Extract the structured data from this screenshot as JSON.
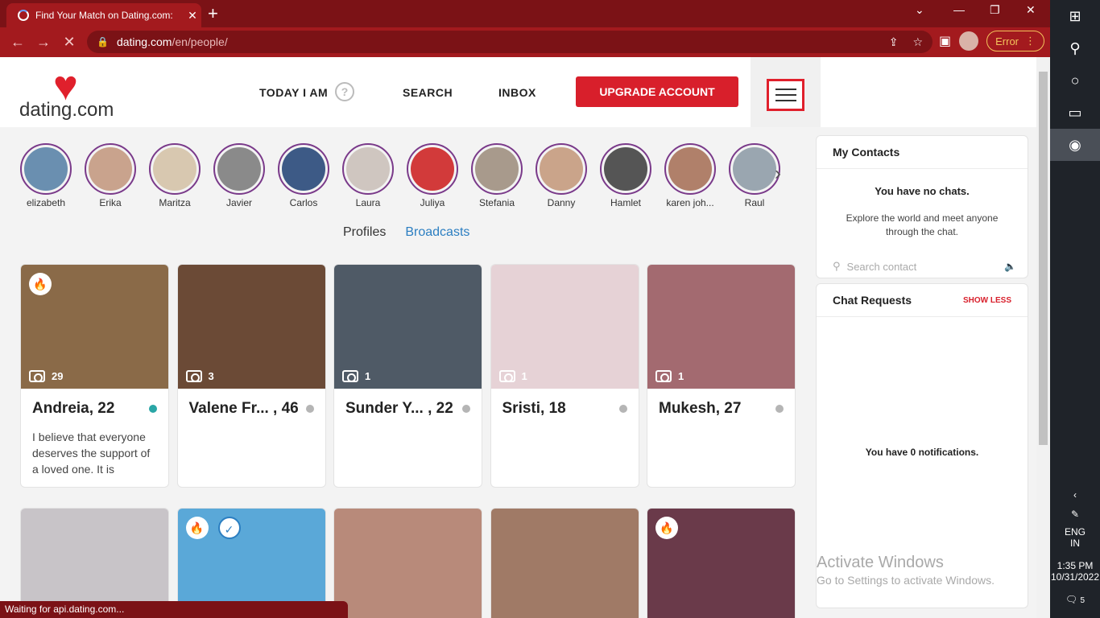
{
  "browser": {
    "tab_title": "Find Your Match on Dating.com:",
    "url_host": "dating.com",
    "url_path": "/en/people/",
    "error_label": "Error",
    "status_text": "Waiting for api.dating.com..."
  },
  "header": {
    "logo_text": "dating.com",
    "nav": {
      "today": "TODAY I AM",
      "search": "SEARCH",
      "inbox": "INBOX"
    },
    "upgrade_label": "UPGRADE ACCOUNT"
  },
  "stories": [
    {
      "name": "elizabeth",
      "color": "#6a8fb0"
    },
    {
      "name": "Erika",
      "color": "#c9a38d"
    },
    {
      "name": "Maritza",
      "color": "#d8c8b0"
    },
    {
      "name": "Javier",
      "color": "#8a8a8a"
    },
    {
      "name": "Carlos",
      "color": "#3d5a86"
    },
    {
      "name": "Laura",
      "color": "#cfc6c0"
    },
    {
      "name": "Juliya",
      "color": "#d23a3a"
    },
    {
      "name": "Stefania",
      "color": "#a89a8c"
    },
    {
      "name": "Danny",
      "color": "#caa48a"
    },
    {
      "name": "Hamlet",
      "color": "#555555"
    },
    {
      "name": "karen joh...",
      "color": "#b0806a"
    },
    {
      "name": "Raul",
      "color": "#9aa6b0"
    }
  ],
  "tabs": {
    "profiles": "Profiles",
    "broadcasts": "Broadcasts"
  },
  "cards_row1": [
    {
      "name": "Andreia, 22",
      "photos": "29",
      "online": true,
      "flame": true,
      "bio": "I believe that everyone deserves the support of a loved one. It is",
      "color": "#8a6a48"
    },
    {
      "name": "Valene Fr... , 46",
      "photos": "3",
      "online": false,
      "flame": false,
      "bio": "",
      "color": "#6b4a36"
    },
    {
      "name": "Sunder Y... , 22",
      "photos": "1",
      "online": false,
      "flame": false,
      "bio": "",
      "color": "#4f5a66"
    },
    {
      "name": "Sristi, 18",
      "photos": "1",
      "online": false,
      "flame": false,
      "bio": "",
      "color": "#e6d2d6"
    },
    {
      "name": "Mukesh, 27",
      "photos": "1",
      "online": false,
      "flame": false,
      "bio": "",
      "color": "#a36a70"
    }
  ],
  "cards_row2": [
    {
      "color": "#c8c4c8",
      "flame": false,
      "verified": false
    },
    {
      "color": "#5aa8d8",
      "flame": true,
      "verified": true
    },
    {
      "color": "#b88a7a",
      "flame": false,
      "verified": false
    },
    {
      "color": "#a07a66",
      "flame": false,
      "verified": false
    },
    {
      "color": "#6a3a4a",
      "flame": true,
      "verified": false
    }
  ],
  "contacts": {
    "title": "My Contacts",
    "no_chats": "You have no chats.",
    "explore": "Explore the world and meet anyone through the chat.",
    "search_placeholder": "Search contact"
  },
  "requests": {
    "title": "Chat Requests",
    "show_less": "SHOW LESS",
    "notifications": "You have 0 notifications."
  },
  "watermark": {
    "line1": "Activate Windows",
    "line2": "Go to Settings to activate Windows."
  },
  "taskbar": {
    "lang1": "ENG",
    "lang2": "IN",
    "time": "1:35 PM",
    "date": "10/31/2022",
    "notif_count": "5"
  }
}
